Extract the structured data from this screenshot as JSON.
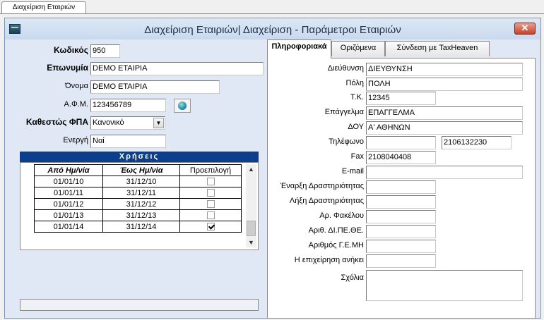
{
  "doc_tab": {
    "label": "Διαχείριση Εταιριών"
  },
  "window": {
    "title": "Διαχείριση Εταιριών| Διαχείριση - Παράμετροι Εταιριών",
    "close_label": "✕"
  },
  "left": {
    "code_label": "Κωδικός",
    "code_value": "950",
    "name_label": "Επωνυμία",
    "name_value": "DEMO ΕΤΑΙΡΙΑ",
    "onoma_label": "Όνομα",
    "onoma_value": "DEMO ΕΤΑΙΡΙΑ",
    "afm_label": "Α.Φ.Μ.",
    "afm_value": "123456789",
    "vat_label": "Καθεστώς ΦΠΑ",
    "vat_value": "Κανονικό",
    "active_label": "Ενεργή",
    "active_value": "Ναί"
  },
  "grid": {
    "title": "Χρήσεις",
    "headers": [
      "Από Ημ/νία",
      "Έως Ημ/νία",
      "Προεπιλογή"
    ],
    "rows": [
      {
        "from": "01/01/10",
        "to": "31/12/10",
        "default": false
      },
      {
        "from": "01/01/11",
        "to": "31/12/11",
        "default": false
      },
      {
        "from": "01/01/12",
        "to": "31/12/12",
        "default": false
      },
      {
        "from": "01/01/13",
        "to": "31/12/13",
        "default": false
      },
      {
        "from": "01/01/14",
        "to": "31/12/14",
        "default": true
      }
    ]
  },
  "tabs": [
    "Πληροφοριακά",
    "Οριζόμενα",
    "Σύνδεση με TaxHeaven"
  ],
  "info": {
    "address_label": "Διεύθυνση",
    "address_value": "ΔΙΕΥΘΥΝΣΗ",
    "city_label": "Πόλη",
    "city_value": "ΠΟΛΗ",
    "zip_label": "Τ.Κ.",
    "zip_value": "12345",
    "job_label": "Επάγγελμα",
    "job_value": "ΕΠΑΓΓΕΛΜΑ",
    "doy_label": "ΔΟΥ",
    "doy_value": "Α' ΑΘΗΝΩΝ",
    "phone_label": "Τηλέφωνο",
    "phone1_value": "",
    "phone2_value": "2106132230",
    "fax_label": "Fax",
    "fax_value": "2108040408",
    "email_label": "E-mail",
    "email_value": "",
    "start_label": "Έναρξη Δραστηριότητας",
    "start_value": "",
    "end_label": "Λήξη Δραστηριότητας",
    "end_value": "",
    "folder_label": "Αρ. Φακέλου",
    "folder_value": "",
    "dipethe_label": "Αριθ. ΔΙ.ΠΕ.ΘΕ.",
    "dipethe_value": "",
    "gemi_label": "Αριθμός Γ.Ε.ΜΗ",
    "gemi_value": "",
    "belongs_label": "Η επιχείρηση ανήκει",
    "belongs_value": "",
    "comments_label": "Σχόλια",
    "comments_value": ""
  }
}
